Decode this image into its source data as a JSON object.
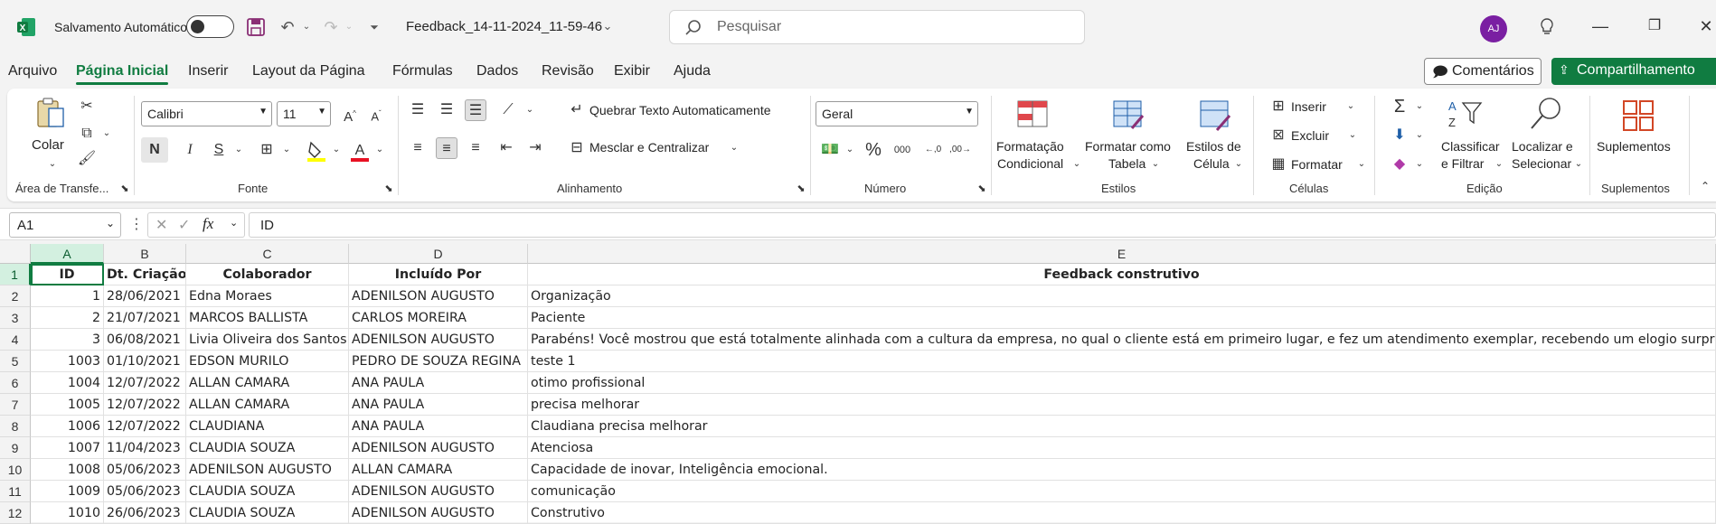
{
  "titlebar": {
    "autosave_label": "Salvamento Automático",
    "filename": "Feedback_14-11-2024_11-59-46",
    "search_placeholder": "Pesquisar",
    "user_initials": "AJ"
  },
  "tabs": [
    "Arquivo",
    "Página Inicial",
    "Inserir",
    "Layout da Página",
    "Fórmulas",
    "Dados",
    "Revisão",
    "Exibir",
    "Ajuda"
  ],
  "active_tab": "Página Inicial",
  "actions": {
    "comments": "Comentários",
    "share": "Compartilhamento"
  },
  "ribbon": {
    "clipboard": {
      "paste": "Colar",
      "label": "Área de Transfe..."
    },
    "font": {
      "name": "Calibri",
      "size": "11",
      "bold": "N",
      "italic": "I",
      "underline": "S",
      "label": "Fonte"
    },
    "alignment": {
      "wrap": "Quebrar Texto Automaticamente",
      "merge": "Mesclar e Centralizar",
      "label": "Alinhamento"
    },
    "number": {
      "format": "Geral",
      "label": "Número"
    },
    "styles": {
      "cond_1": "Formatação",
      "cond_2": "Condicional",
      "table_1": "Formatar como",
      "table_2": "Tabela",
      "cell_1": "Estilos de",
      "cell_2": "Célula",
      "label": "Estilos"
    },
    "cells": {
      "insert": "Inserir",
      "delete": "Excluir",
      "format": "Formatar",
      "label": "Células"
    },
    "editing": {
      "sort_1": "Classificar",
      "sort_2": "e Filtrar",
      "find_1": "Localizar e",
      "find_2": "Selecionar",
      "label": "Edição"
    },
    "addins": {
      "name": "Suplementos",
      "label": "Suplementos"
    }
  },
  "formula_bar": {
    "cell_ref": "A1",
    "value": "ID"
  },
  "accent": "#107c41",
  "sheet": {
    "columns": [
      "A",
      "B",
      "C",
      "D",
      "E"
    ],
    "rows": [
      [
        "ID",
        "Dt. Criação",
        "Colaborador",
        "Incluído Por",
        "Feedback construtivo"
      ],
      [
        "1",
        "28/06/2021",
        "Edna Moraes",
        "ADENILSON AUGUSTO",
        "Organização"
      ],
      [
        "2",
        "21/07/2021",
        "MARCOS BALLISTA",
        "CARLOS MOREIRA",
        "Paciente"
      ],
      [
        "3",
        "06/08/2021",
        "Livia Oliveira dos Santos",
        "ADENILSON AUGUSTO",
        "Parabéns! Você mostrou que está totalmente alinhada com a cultura da empresa, no qual o cliente está em primeiro lugar, e fez um atendimento exemplar, recebendo um elogio surpre"
      ],
      [
        "1003",
        "01/10/2021",
        "EDSON MURILO",
        "PEDRO DE SOUZA REGINA",
        "teste 1"
      ],
      [
        "1004",
        "12/07/2022",
        "ALLAN CAMARA",
        "ANA PAULA",
        "otimo profissional"
      ],
      [
        "1005",
        "12/07/2022",
        "ALLAN CAMARA",
        "ANA PAULA",
        "precisa melhorar"
      ],
      [
        "1006",
        "12/07/2022",
        "CLAUDIANA",
        "ANA PAULA",
        "Claudiana precisa melhorar"
      ],
      [
        "1007",
        "11/04/2023",
        "CLAUDIA SOUZA",
        "ADENILSON AUGUSTO",
        "Atenciosa"
      ],
      [
        "1008",
        "05/06/2023",
        "ADENILSON AUGUSTO",
        "ALLAN CAMARA",
        "Capacidade de inovar, Inteligência emocional."
      ],
      [
        "1009",
        "05/06/2023",
        "CLAUDIA SOUZA",
        "ADENILSON AUGUSTO",
        "comunicação"
      ],
      [
        "1010",
        "26/06/2023",
        "CLAUDIA SOUZA",
        "ADENILSON AUGUSTO",
        "Construtivo"
      ]
    ]
  }
}
